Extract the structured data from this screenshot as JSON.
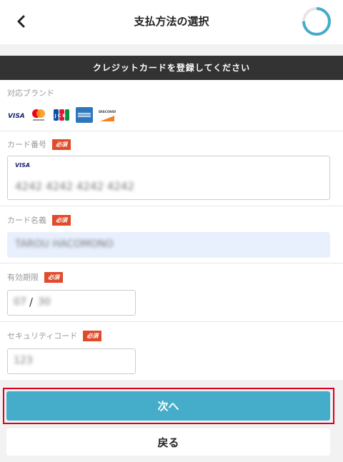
{
  "header": {
    "title": "支払方法の選択",
    "progress_fraction": 0.75,
    "accent_color": "#45acc9"
  },
  "banner": {
    "text": "クレジットカードを登録してください"
  },
  "brands": {
    "label": "対応ブランド",
    "items": [
      "VISA",
      "Mastercard",
      "JCB",
      "American Express",
      "DISCOVER"
    ]
  },
  "card_number": {
    "label": "カード番号",
    "required": "必須",
    "detected_brand": "VISA",
    "value": "4242 4242 4242 4242"
  },
  "card_name": {
    "label": "カード名義",
    "required": "必須",
    "value": "TAROU HACOMONO"
  },
  "expiry": {
    "label": "有効期限",
    "required": "必須",
    "month": "07",
    "separator": "/",
    "year": "30"
  },
  "security_code": {
    "label": "セキュリティコード",
    "required": "必須",
    "value": "123"
  },
  "buttons": {
    "next": "次へ",
    "back": "戻る"
  }
}
